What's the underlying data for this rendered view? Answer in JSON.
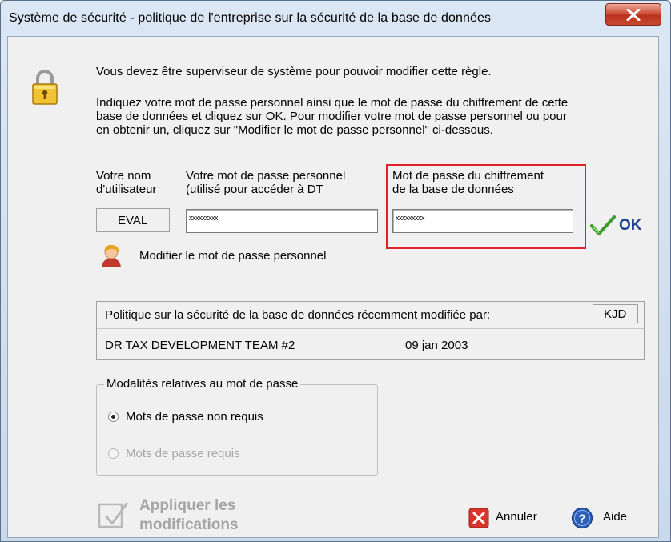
{
  "window": {
    "title": "Système de sécurité - politique de l'entreprise sur la sécurité de la base de données"
  },
  "intro": {
    "line1": "Vous devez être superviseur de système pour pouvoir modifier cette règle.",
    "para": [
      "Indiquez votre mot de passe personnel ainsi que le mot de passe du chiffrement de cette",
      "base de données et cliquez sur OK. Pour modifier votre mot de passe personnel ou pour",
      "en obtenir un, cliquez sur \"Modifier le mot de passe personnel\" ci-dessous."
    ]
  },
  "user": {
    "label_line1": "Votre nom",
    "label_line2": "d'utilisateur",
    "value": "EVAL"
  },
  "personal_password": {
    "label_line1": "Votre mot de passe personnel",
    "label_line2": "(utilisé pour accéder à DT",
    "value": "xxxxxxxxx"
  },
  "db_password": {
    "label_line1": "Mot de passe du chiffrement",
    "label_line2": "de la base de données",
    "value": "xxxxxxxxx"
  },
  "ok_label": "OK",
  "change_password_label": "Modifier le mot de passe personnel",
  "policy": {
    "label": "Politique sur la sécurité de la base de données récemment modifiée par:",
    "initials": "KJD",
    "team": "DR TAX DEVELOPMENT TEAM #2",
    "date": "09 jan 2003"
  },
  "password_group": {
    "title": "Modalités relatives au mot de passe",
    "option1": "Mots de passe non requis",
    "option2": "Mots de passe requis",
    "selected": "option1"
  },
  "buttons": {
    "apply_line1": "Appliquer les",
    "apply_line2": "modifications",
    "cancel": "Annuler",
    "help": "Aide"
  },
  "colors": {
    "highlight_border": "#e0202a",
    "ok_text": "#1f3f8f",
    "disabled_text": "#a5a5a5"
  }
}
